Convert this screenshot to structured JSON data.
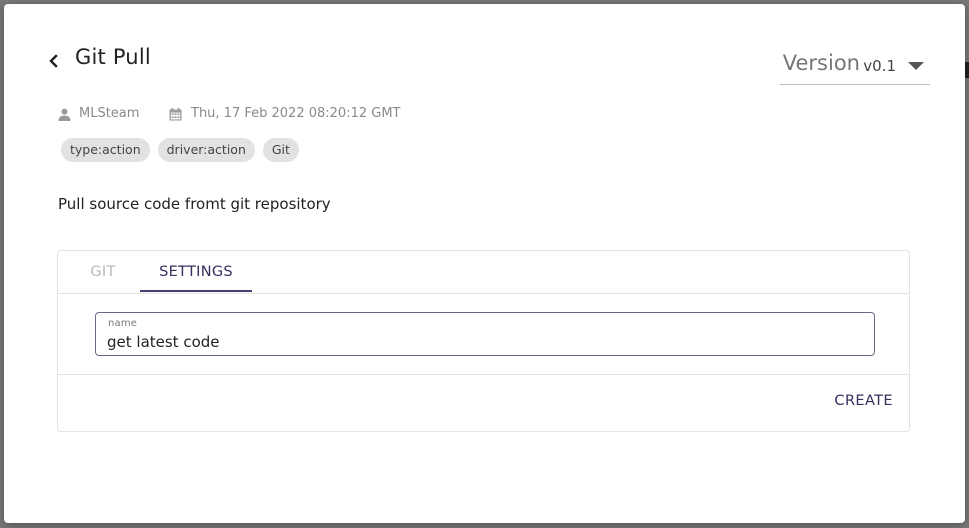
{
  "dialog": {
    "title": "Git Pull",
    "back_icon": "chevron-left-icon",
    "version": {
      "label": "Version",
      "value": "v0.1",
      "caret_icon": "caret-down-icon"
    }
  },
  "meta": {
    "author_icon": "user-icon",
    "author": "MLSteam",
    "date_icon": "calendar-icon",
    "date": "Thu, 17 Feb 2022 08:20:12 GMT"
  },
  "tags": [
    "type:action",
    "driver:action",
    "Git"
  ],
  "description": "Pull source code fromt git repository",
  "tabs": [
    {
      "label": "GIT",
      "active": false
    },
    {
      "label": "SETTINGS",
      "active": true
    }
  ],
  "form": {
    "name_label": "name",
    "name_value": "get latest code"
  },
  "actions": {
    "create_label": "CREATE"
  },
  "colors": {
    "accent": "#4a3b73",
    "tag_bg": "#e2e2e2",
    "muted_text": "#8a8a8a"
  }
}
